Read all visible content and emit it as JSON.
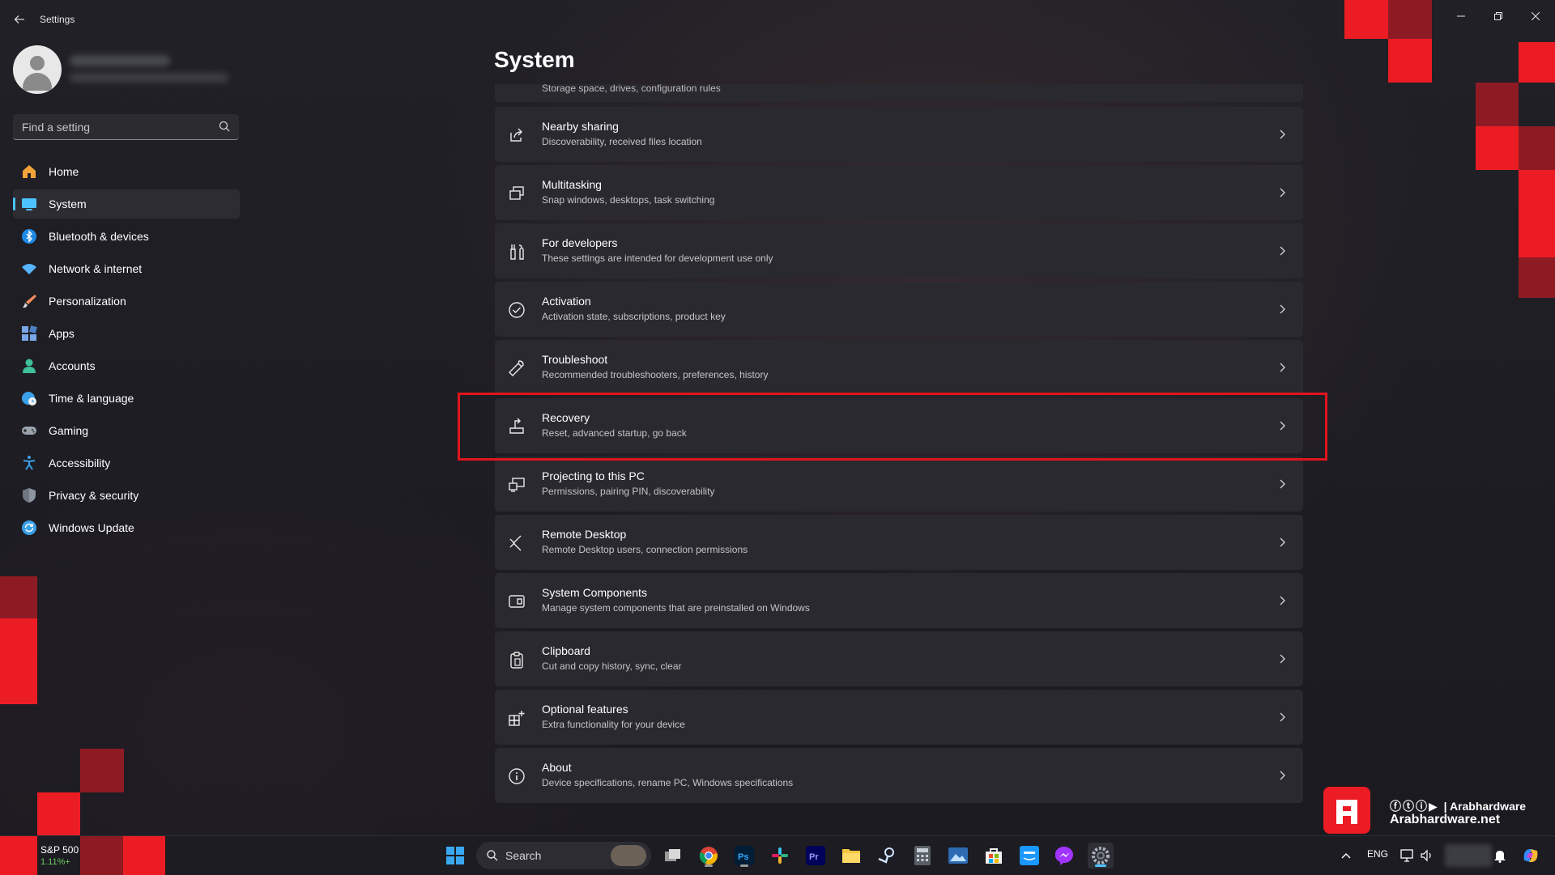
{
  "window": {
    "app_title": "Settings",
    "back_icon": "back-arrow-icon",
    "controls": [
      "minimize-icon",
      "restore-icon",
      "close-icon"
    ]
  },
  "sidebar": {
    "search_placeholder": "Find a setting",
    "items": [
      {
        "label": "Home",
        "icon": "home-icon",
        "color": "#f2a33a"
      },
      {
        "label": "System",
        "icon": "system-icon",
        "color": "#4cc2ff",
        "active": true
      },
      {
        "label": "Bluetooth & devices",
        "icon": "bluetooth-icon",
        "color": "#1e88e5"
      },
      {
        "label": "Network & internet",
        "icon": "wifi-icon",
        "color": "#58b4ff"
      },
      {
        "label": "Personalization",
        "icon": "brush-icon",
        "color": "#f08a5d"
      },
      {
        "label": "Apps",
        "icon": "apps-icon",
        "color": "#7aa7e8"
      },
      {
        "label": "Accounts",
        "icon": "accounts-icon",
        "color": "#3fbf9a"
      },
      {
        "label": "Time & language",
        "icon": "globe-clock-icon",
        "color": "#3aa0e8"
      },
      {
        "label": "Gaming",
        "icon": "gamepad-icon",
        "color": "#9aa3ad"
      },
      {
        "label": "Accessibility",
        "icon": "accessibility-icon",
        "color": "#3aa0e8"
      },
      {
        "label": "Privacy & security",
        "icon": "shield-icon",
        "color": "#8d96a0"
      },
      {
        "label": "Windows Update",
        "icon": "update-icon",
        "color": "#3aa0e8"
      }
    ]
  },
  "main": {
    "title": "System",
    "partial_row_sub": "Storage space, drives, configuration rules",
    "rows": [
      {
        "title": "Nearby sharing",
        "sub": "Discoverability, received files location",
        "icon": "share-icon"
      },
      {
        "title": "Multitasking",
        "sub": "Snap windows, desktops, task switching",
        "icon": "multitasking-icon"
      },
      {
        "title": "For developers",
        "sub": "These settings are intended for development use only",
        "icon": "developer-tools-icon"
      },
      {
        "title": "Activation",
        "sub": "Activation state, subscriptions, product key",
        "icon": "check-circle-icon"
      },
      {
        "title": "Troubleshoot",
        "sub": "Recommended troubleshooters, preferences, history",
        "icon": "wrench-icon"
      },
      {
        "title": "Recovery",
        "sub": "Reset, advanced startup, go back",
        "icon": "recovery-icon"
      },
      {
        "title": "Projecting to this PC",
        "sub": "Permissions, pairing PIN, discoverability",
        "icon": "projecting-icon"
      },
      {
        "title": "Remote Desktop",
        "sub": "Remote Desktop users, connection permissions",
        "icon": "remote-desktop-icon"
      },
      {
        "title": "System Components",
        "sub": "Manage system components that are preinstalled on Windows",
        "icon": "components-icon"
      },
      {
        "title": "Clipboard",
        "sub": "Cut and copy history, sync, clear",
        "icon": "clipboard-icon"
      },
      {
        "title": "Optional features",
        "sub": "Extra functionality for your device",
        "icon": "optional-features-icon"
      },
      {
        "title": "About",
        "sub": "Device specifications, rename PC, Windows specifications",
        "icon": "info-icon"
      }
    ],
    "highlighted_row": "Recovery",
    "highlight_color": "#e1141d"
  },
  "brand": {
    "social_line": "| Arabhardware",
    "site": "Arabhardware.net",
    "color": "#ec1c24"
  },
  "taskbar": {
    "widget_title": "S&P 500",
    "widget_value": "1.11%+",
    "search_placeholder": "Search",
    "apps": [
      "windows-start-icon",
      "search-icon",
      "task-view-icon",
      "chrome-icon",
      "photoshop-icon",
      "slack-icon",
      "premiere-icon",
      "file-explorer-icon",
      "steam-icon",
      "calculator-icon",
      "photos-icon",
      "store-icon",
      "prime-video-icon",
      "messenger-icon",
      "settings-icon"
    ],
    "language": "ENG",
    "tray_icons": [
      "chevron-up-icon",
      "network-icon",
      "volume-icon",
      "notification-bell-icon",
      "copilot-icon"
    ]
  }
}
